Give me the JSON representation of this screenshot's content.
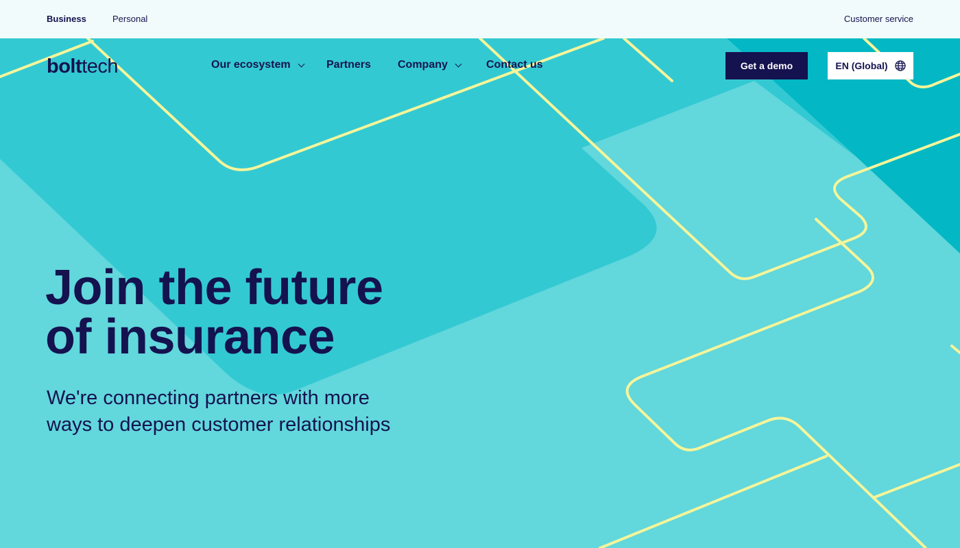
{
  "topbar": {
    "business": "Business",
    "personal": "Personal",
    "customer_service": "Customer service"
  },
  "logo": {
    "part1": "bolt",
    "part2": "tech"
  },
  "nav": {
    "ecosystem": "Our ecosystem",
    "partners": "Partners",
    "company": "Company",
    "contact": "Contact us"
  },
  "actions": {
    "demo": "Get a demo",
    "language": "EN (Global)"
  },
  "hero": {
    "title_line1": "Join the future",
    "title_line2": "of insurance",
    "subtitle_line1": "We're connecting partners with more",
    "subtitle_line2": "ways to deepen customer relationships"
  },
  "icons": {
    "globe": "globe-icon",
    "chevron": "chevron-down-icon"
  },
  "colors": {
    "navy": "#14124f",
    "teal_light": "#62d7dc",
    "teal_mid": "#33c9d3",
    "teal_dark": "#03b8c4",
    "line_yellow": "#f5f59a",
    "topbar_bg": "#f2fbfb"
  }
}
